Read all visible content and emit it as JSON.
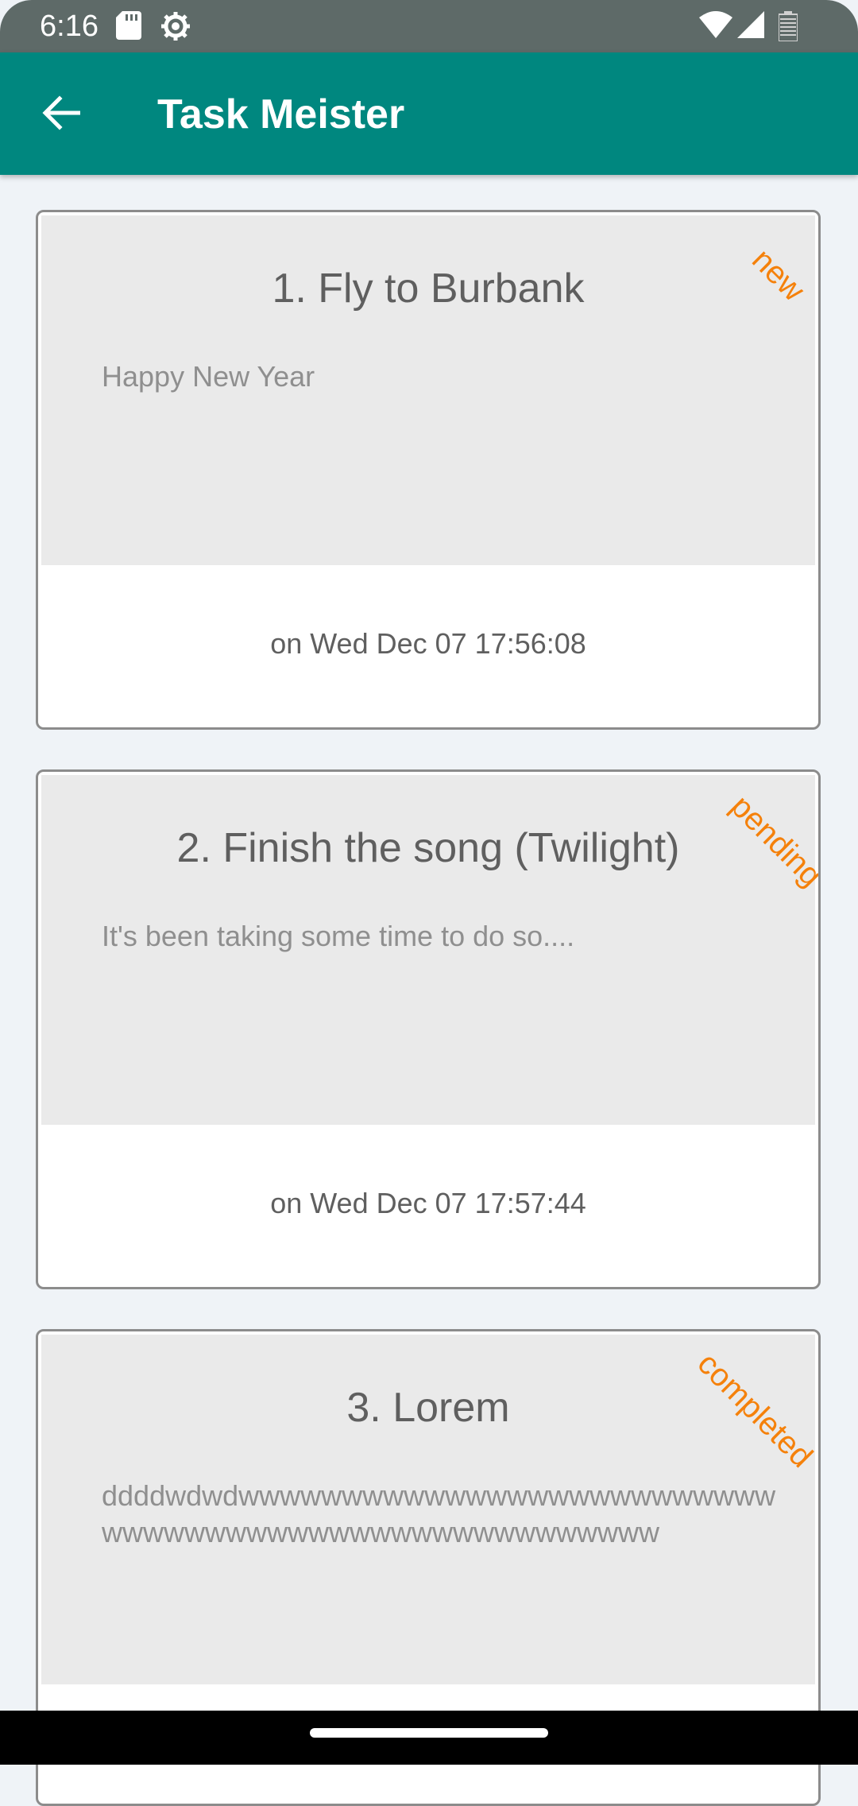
{
  "status_bar": {
    "time": "6:16",
    "icons": [
      "sd-card-icon",
      "settings-gear-icon",
      "wifi-icon",
      "cell-signal-icon",
      "battery-icon"
    ]
  },
  "app_bar": {
    "title": "Task Meister",
    "back_icon": "arrow-back-icon",
    "color": "#00877f"
  },
  "tasks": [
    {
      "title": "1. Fly to Burbank",
      "description": "Happy New Year",
      "status": "new",
      "date": "on Wed Dec 07 17:56:08"
    },
    {
      "title": "2. Finish the song (Twilight)",
      "description": "It's been taking some time to do so....",
      "status": "pending",
      "date": "on Wed Dec 07 17:57:44"
    },
    {
      "title": "3. Lorem",
      "description": "ddddwdwdwwwwwwwwwwwwwwwwwwwwwwwwwwwwwwwwwwwwwwwwwwwwwwwwwwwww",
      "status": "completed",
      "date": ""
    }
  ],
  "colors": {
    "status_accent": "#f5810b",
    "background": "#eff3f7",
    "card_body": "#eaeaea"
  }
}
